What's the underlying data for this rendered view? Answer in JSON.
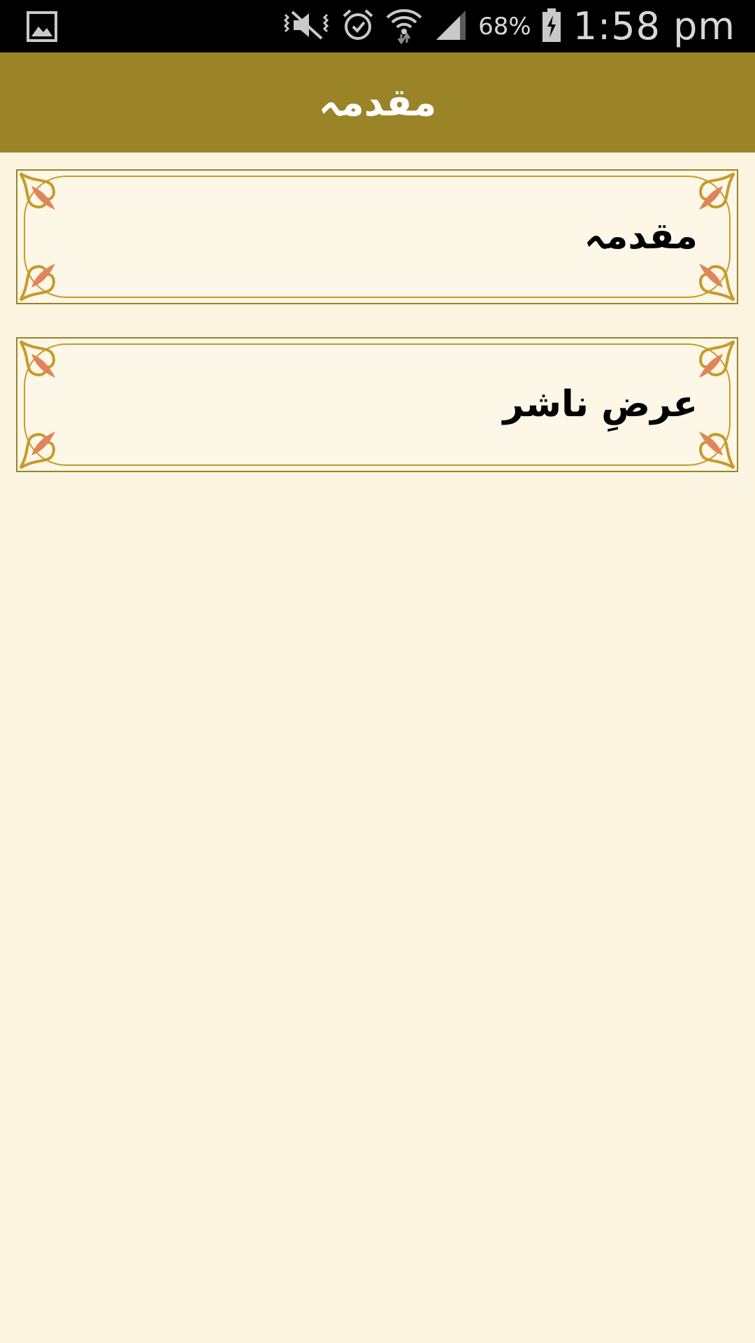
{
  "status_bar": {
    "battery_percent": "68%",
    "time": "1:58 pm",
    "icons": [
      "gallery-icon",
      "mute-vibrate-icon",
      "alarm-icon",
      "wifi-icon",
      "signal-icon",
      "battery-charging-icon"
    ]
  },
  "app_bar": {
    "title": "مقدمہ"
  },
  "list": {
    "items": [
      {
        "label": "مقدمہ"
      },
      {
        "label": "عرضِ ناشر"
      }
    ]
  },
  "colors": {
    "accent": "#9b8427",
    "background": "#faf4e1",
    "ornament": "#c89a2a",
    "ornament_leaf": "#e0855a"
  }
}
